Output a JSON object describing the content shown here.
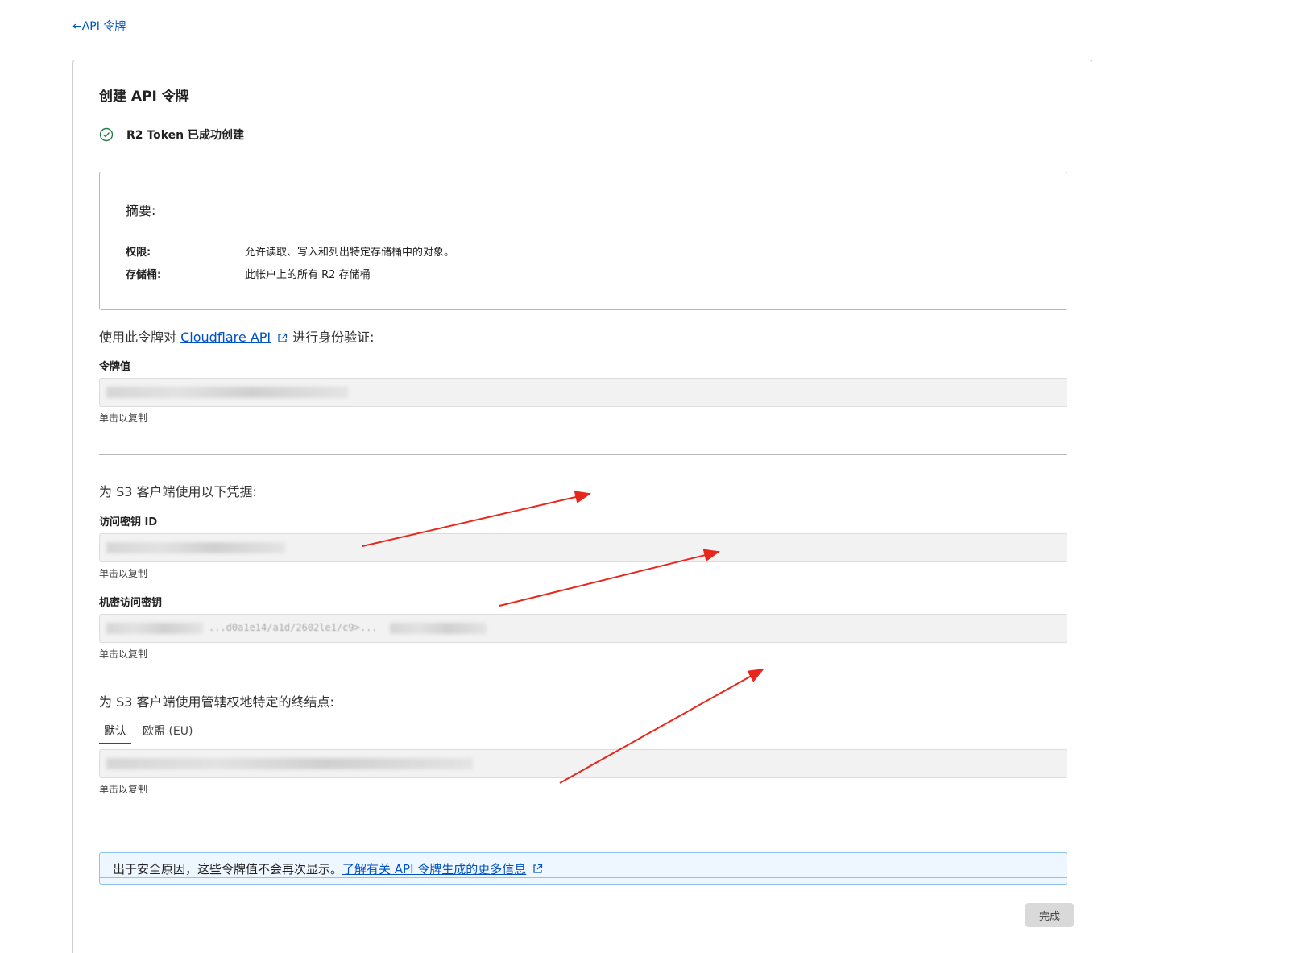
{
  "back_link": {
    "label": "←API 令牌"
  },
  "card": {
    "title": "创建 API 令牌",
    "success_text": "R2 Token 已成功创建",
    "summary": {
      "heading": "摘要:",
      "rows": [
        {
          "label": "权限:",
          "value": "允许读取、写入和列出特定存储桶中的对象。"
        },
        {
          "label": "存储桶:",
          "value": "此帐户上的所有 R2 存储桶"
        }
      ]
    },
    "auth": {
      "prefix": "使用此令牌对 ",
      "link": "Cloudflare API",
      "suffix": "进行身份验证:",
      "token_label": "令牌值",
      "copy_hint": "单击以复制"
    },
    "s3": {
      "heading": "为 S3 客户端使用以下凭据:",
      "access_key_label": "访问密钥 ID",
      "secret_key_label": "机密访问密钥",
      "secret_partial": "...d0a1e14/a1d/2602le1/c9>...",
      "copy_hint": "单击以复制"
    },
    "endpoint": {
      "heading": "为 S3 客户端使用管辖权地特定的终结点:",
      "tabs": [
        "默认",
        "欧盟 (EU)"
      ],
      "copy_hint": "单击以复制"
    },
    "banner": {
      "text": "出于安全原因，这些令牌值不会再次显示。",
      "link": "了解有关 API 令牌生成的更多信息"
    },
    "done_button": "完成"
  },
  "colors": {
    "link": "#0051c3",
    "success": "#2c7a4b",
    "arrow": "#e8271c",
    "banner_bg": "#eef6ff"
  },
  "icons": [
    "check-circle-icon",
    "external-link-icon"
  ]
}
